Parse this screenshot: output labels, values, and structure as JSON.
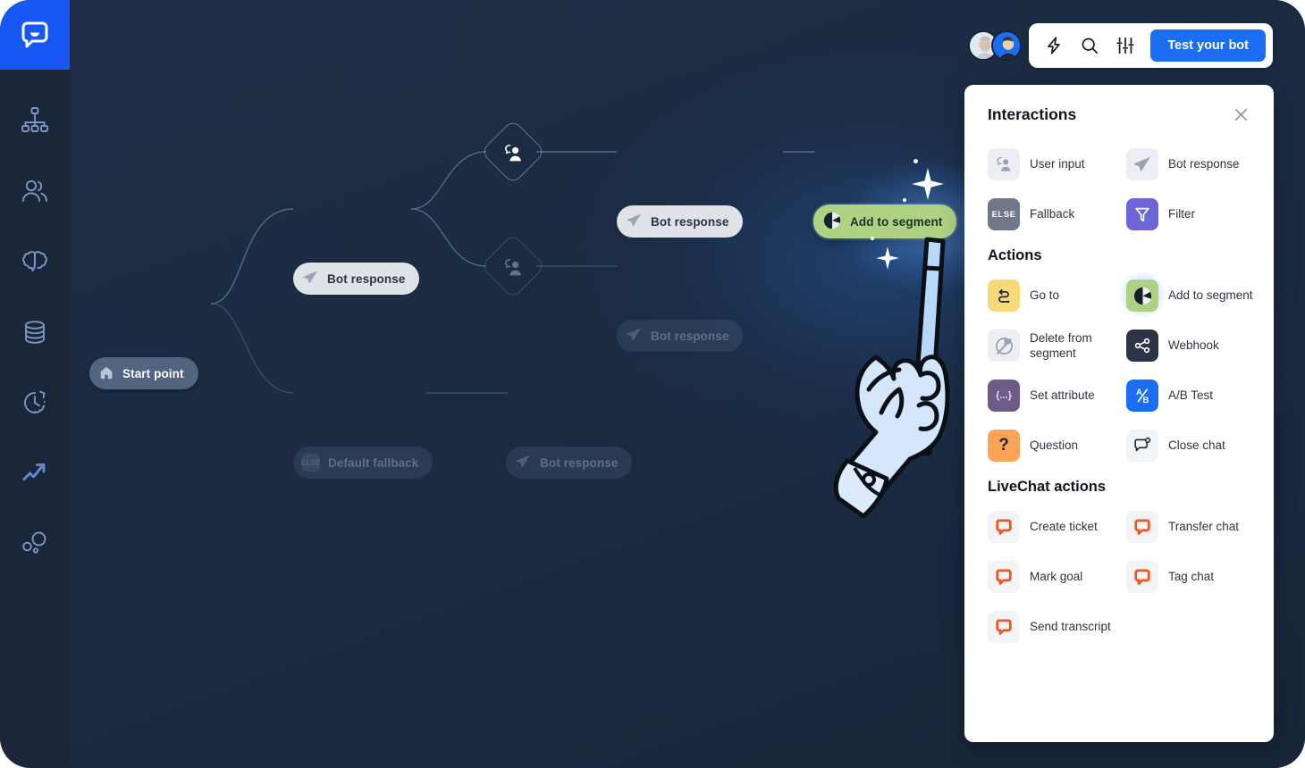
{
  "brand": {
    "logo_icon": "chatbot-logo-icon",
    "accent": "#1757f5"
  },
  "sidebar": {
    "items": [
      {
        "icon": "sitemap-icon",
        "name": "stories"
      },
      {
        "icon": "users-icon",
        "name": "users"
      },
      {
        "icon": "brain-icon",
        "name": "training"
      },
      {
        "icon": "database-icon",
        "name": "knowledge-base"
      },
      {
        "icon": "history-icon",
        "name": "archives"
      },
      {
        "icon": "trending-up-icon",
        "name": "reports"
      },
      {
        "icon": "bubbles-icon",
        "name": "integrations"
      }
    ]
  },
  "topbar": {
    "avatars": [
      "avatar-user-1",
      "avatar-user-2"
    ],
    "icons": [
      {
        "name": "lightning-icon"
      },
      {
        "name": "search-icon"
      },
      {
        "name": "sliders-icon"
      }
    ],
    "test_button": "Test your bot"
  },
  "canvas": {
    "nodes": [
      {
        "id": "start",
        "label": "Start point",
        "icon": "home-icon",
        "style": "start"
      },
      {
        "id": "bot1",
        "label": "Bot response",
        "icon": "paper-plane-icon",
        "style": "bot"
      },
      {
        "id": "userin1",
        "label": "",
        "icon": "user-input-icon",
        "style": "diamond"
      },
      {
        "id": "userin2",
        "label": "",
        "icon": "user-input-icon",
        "style": "diamond-dim"
      },
      {
        "id": "bot2",
        "label": "Bot response",
        "icon": "paper-plane-icon",
        "style": "bot"
      },
      {
        "id": "bot3",
        "label": "Bot response",
        "icon": "paper-plane-icon",
        "style": "dim"
      },
      {
        "id": "segment",
        "label": "Add to segment",
        "icon": "segment-icon",
        "style": "selected"
      },
      {
        "id": "fallback",
        "label": "Default fallback",
        "icon": "else-icon",
        "style": "dim"
      },
      {
        "id": "bot4",
        "label": "Bot response",
        "icon": "paper-plane-icon",
        "style": "dim"
      }
    ],
    "cursor": "hand-with-magic-wand"
  },
  "panel": {
    "title": "Interactions",
    "close_icon": "close-icon",
    "interactions": [
      {
        "label": "User input",
        "icon": "user-input-icon",
        "tile": "t-grey"
      },
      {
        "label": "Bot response",
        "icon": "paper-plane-icon",
        "tile": "t-grey"
      },
      {
        "label": "Fallback",
        "icon": "else-icon",
        "tile": "t-slate"
      },
      {
        "label": "Filter",
        "icon": "funnel-icon",
        "tile": "t-purple"
      }
    ],
    "actions_title": "Actions",
    "actions": [
      {
        "label": "Go to",
        "icon": "route-icon",
        "tile": "t-yellow",
        "highlight": false
      },
      {
        "label": "Add to segment",
        "icon": "segment-icon",
        "tile": "t-green",
        "highlight": true
      },
      {
        "label": "Delete from segment",
        "icon": "segment-off-icon",
        "tile": "t-grey",
        "highlight": false
      },
      {
        "label": "Webhook",
        "icon": "share-nodes-icon",
        "tile": "t-dark",
        "highlight": false
      },
      {
        "label": "Set attribute",
        "icon": "braces-icon",
        "tile": "t-plum",
        "highlight": false
      },
      {
        "label": "A/B Test",
        "icon": "ab-test-icon",
        "tile": "t-blue",
        "highlight": false
      },
      {
        "label": "Question",
        "icon": "question-icon",
        "tile": "t-orange",
        "highlight": false
      },
      {
        "label": "Close chat",
        "icon": "chat-close-icon",
        "tile": "t-lite",
        "highlight": false
      }
    ],
    "livechat_title": "LiveChat actions",
    "livechat": [
      {
        "label": "Create ticket",
        "icon": "livechat-icon",
        "tile": "t-lite"
      },
      {
        "label": "Transfer chat",
        "icon": "livechat-icon",
        "tile": "t-lite"
      },
      {
        "label": "Mark goal",
        "icon": "livechat-icon",
        "tile": "t-lite"
      },
      {
        "label": "Tag chat",
        "icon": "livechat-icon",
        "tile": "t-lite"
      },
      {
        "label": "Send transcript",
        "icon": "livechat-icon",
        "tile": "t-lite"
      }
    ]
  }
}
